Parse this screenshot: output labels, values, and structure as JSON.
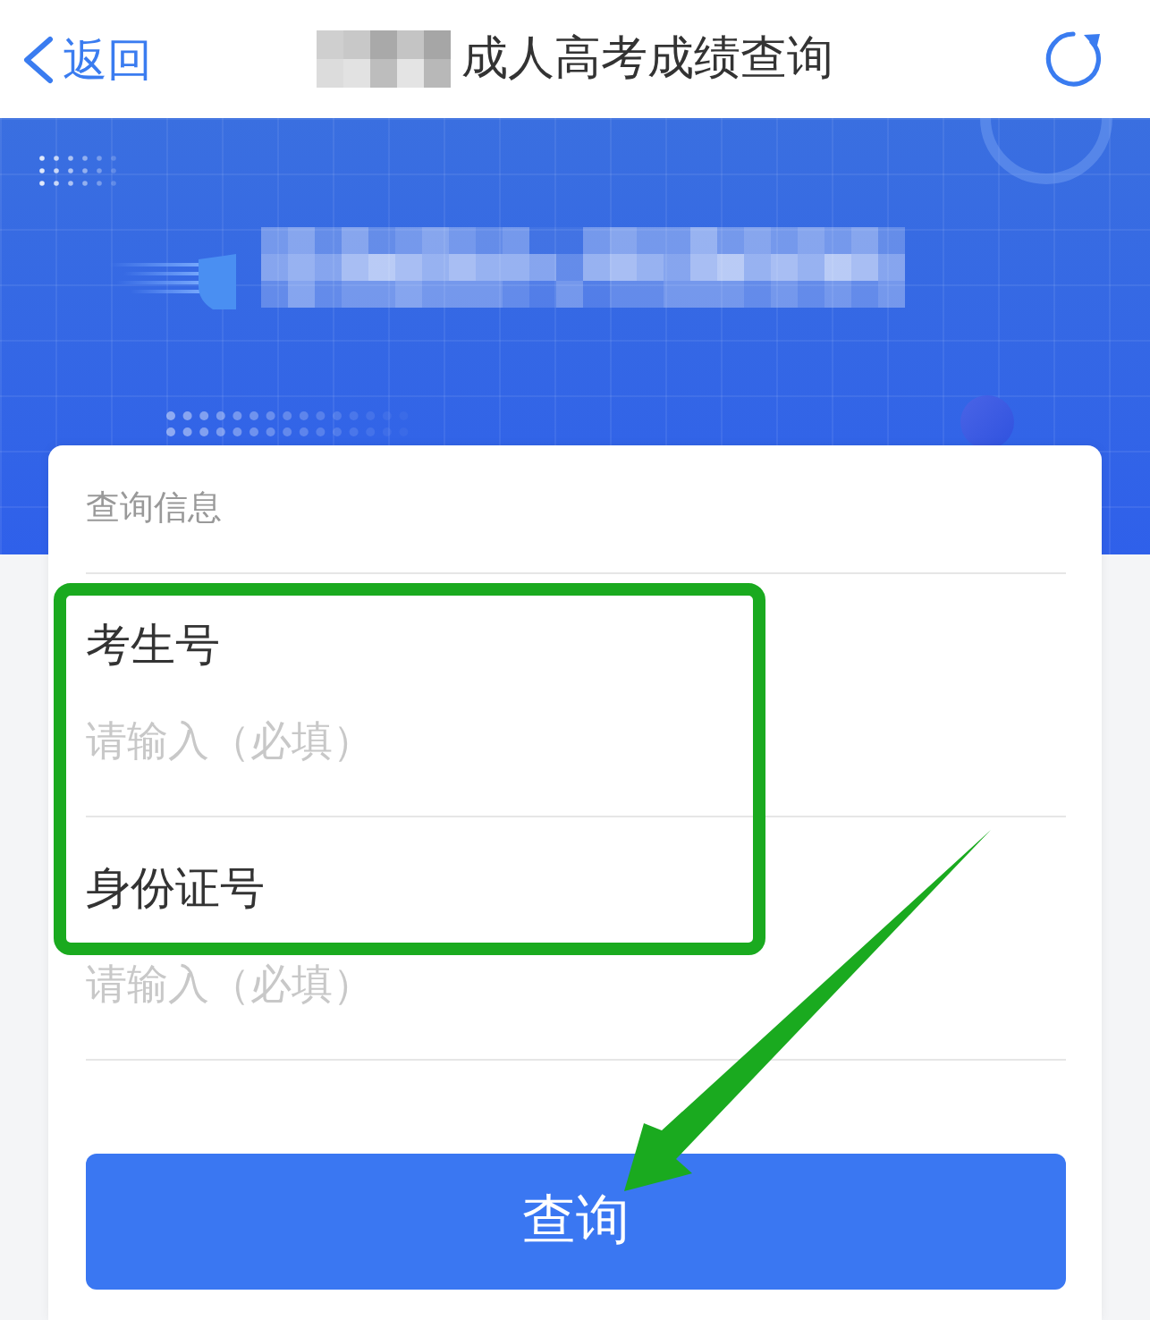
{
  "nav_bar": {
    "back_label": "返回",
    "title": "成人高考成绩查询"
  },
  "query_form": {
    "section_title": "查询信息",
    "fields": [
      {
        "label": "考生号",
        "placeholder": "请输入（必填）"
      },
      {
        "label": "身份证号",
        "placeholder": "请输入（必填）"
      }
    ],
    "submit_label": "查询"
  }
}
